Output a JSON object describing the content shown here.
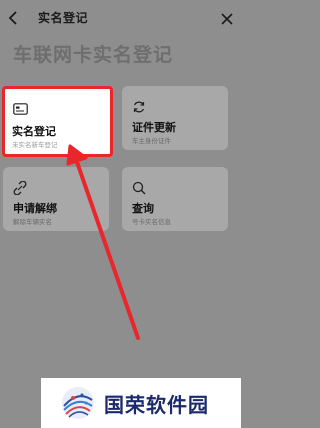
{
  "header": {
    "title": "实名登记",
    "back_icon": "back-icon",
    "close_icon": "close-icon"
  },
  "page": {
    "title": "车联网卡实名登记"
  },
  "cards": [
    {
      "title": "实名登记",
      "subtitle": "未实名新车登记",
      "icon": "id-card-icon"
    },
    {
      "title": "证件更新",
      "subtitle": "车主身份证件",
      "icon": "refresh-icon"
    },
    {
      "title": "申请解绑",
      "subtitle": "解除车辆实名",
      "icon": "unlink-icon"
    },
    {
      "title": "查询",
      "subtitle": "号卡实名信息",
      "icon": "search-icon"
    }
  ],
  "watermark": {
    "text": "国荣软件园",
    "icon": "globe-logo-icon"
  },
  "colors": {
    "overlay": "#8e8e8e",
    "card": "#a8a8a8",
    "highlight": "#e8262b",
    "arrow": "#e8262b",
    "watermark_text": "#1c2a6b"
  }
}
